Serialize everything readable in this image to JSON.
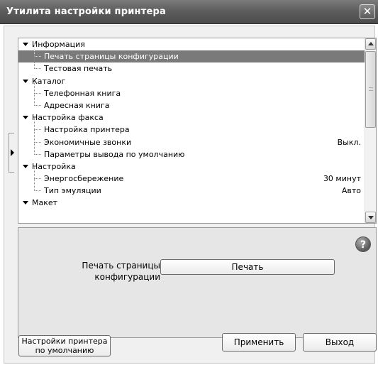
{
  "window": {
    "title": "Утилита настройки принтера",
    "close_glyph": "✕"
  },
  "tree": {
    "items": [
      {
        "type": "category",
        "label": "Информация"
      },
      {
        "type": "child",
        "label": "Печать страницы конфигурации",
        "value": "",
        "selected": true
      },
      {
        "type": "child",
        "label": "Тестовая печать",
        "value": ""
      },
      {
        "type": "category",
        "label": "Каталог"
      },
      {
        "type": "child",
        "label": "Телефонная книга",
        "value": ""
      },
      {
        "type": "child",
        "label": "Адресная книга",
        "value": ""
      },
      {
        "type": "category",
        "label": "Настройка факса"
      },
      {
        "type": "child",
        "label": "Настройка принтера",
        "value": ""
      },
      {
        "type": "child",
        "label": "Экономичные звонки",
        "value": "Выкл."
      },
      {
        "type": "child",
        "label": "Параметры вывода по умолчанию",
        "value": ""
      },
      {
        "type": "category",
        "label": "Настройка"
      },
      {
        "type": "child",
        "label": "Энергосбережение",
        "value": "30 минут"
      },
      {
        "type": "child",
        "label": "Тип эмуляции",
        "value": "Авто"
      },
      {
        "type": "category",
        "label": "Макет"
      }
    ]
  },
  "detail": {
    "label_line1": "Печать страницы",
    "label_line2": "конфигурации",
    "print_button": "Печать",
    "help_glyph": "?"
  },
  "footer": {
    "defaults_line1": "Настройки принтера",
    "defaults_line2": "по умолчанию",
    "apply_button": "Применить",
    "exit_button": "Выход"
  },
  "icons": {
    "help": "help-icon",
    "close": "close-icon",
    "collapse": "chevron-down-icon",
    "panel_toggle": "chevron-right-icon"
  },
  "colors": {
    "titlebar": "#5e5e5e",
    "selection": "#7a7a7a",
    "panel_bg": "#e6e6e6"
  }
}
